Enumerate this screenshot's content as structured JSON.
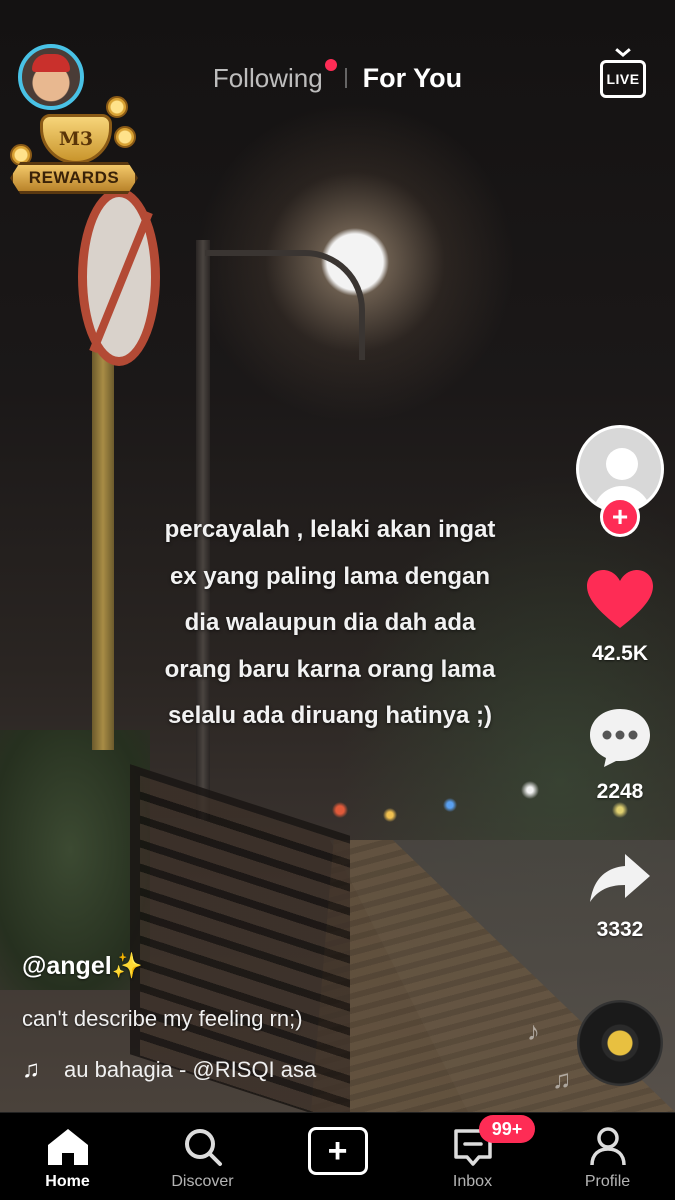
{
  "header": {
    "tabs": [
      {
        "label": "Following",
        "has_dot": true
      },
      {
        "label": "For You",
        "active": true
      }
    ],
    "live_label": "LIVE"
  },
  "rewards": {
    "badge": "M3",
    "label": "REWARDS"
  },
  "video": {
    "overlay_lines": [
      "percayalah , lelaki akan ingat",
      "ex yang paling lama dengan",
      "dia walaupun dia dah ada",
      "orang baru karna orang lama",
      "selalu ada diruang hatinya ;)"
    ],
    "username": "@angel✨",
    "description": "can't describe my feeling rn;)",
    "music_track": "au bahagia - @RISQI     asa"
  },
  "rail": {
    "likes": "42.5K",
    "comments": "2248",
    "shares": "3332"
  },
  "bottom_nav": {
    "items": [
      {
        "label": "Home",
        "icon": "home-icon",
        "active": true
      },
      {
        "label": "Discover",
        "icon": "search-icon"
      },
      {
        "label": "",
        "icon": "plus-icon"
      },
      {
        "label": "Inbox",
        "icon": "inbox-icon",
        "badge": "99+"
      },
      {
        "label": "Profile",
        "icon": "profile-icon"
      }
    ]
  },
  "colors": {
    "accent": "#fe2c55",
    "avatar_ring": "#49c2e6"
  }
}
